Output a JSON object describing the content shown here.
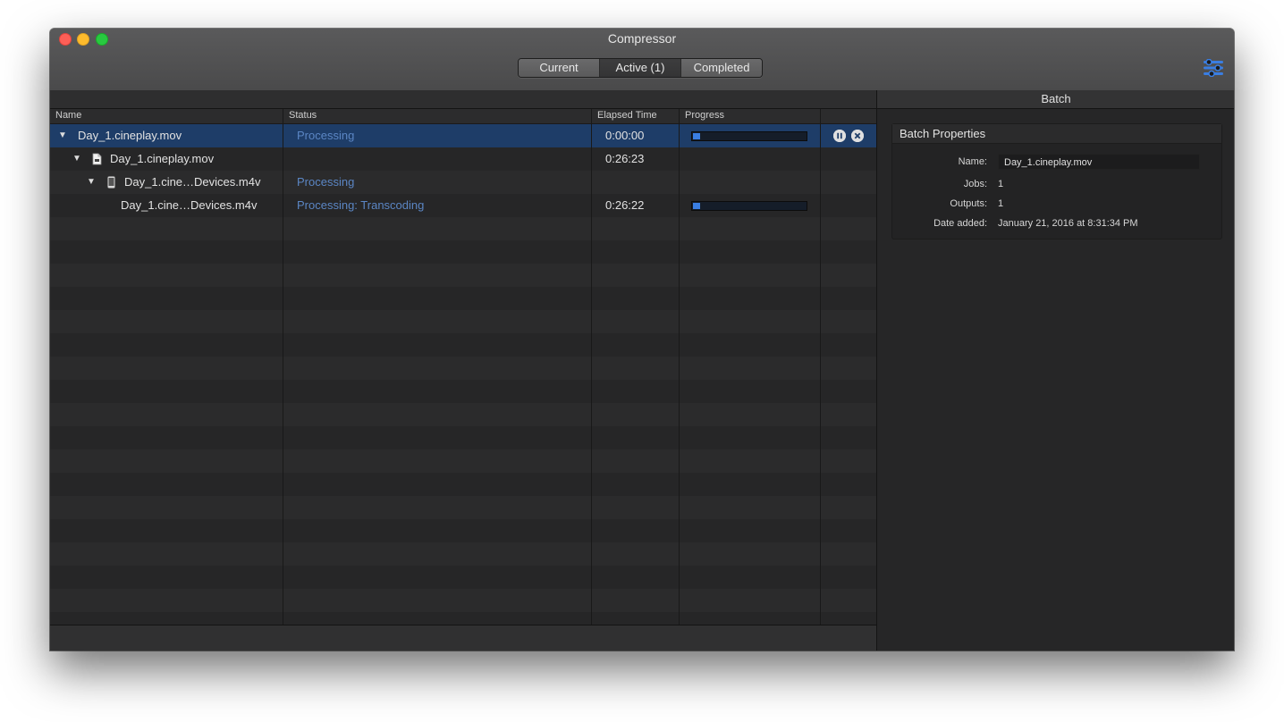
{
  "window": {
    "title": "Compressor"
  },
  "tabs": [
    {
      "label": "Current",
      "active": false
    },
    {
      "label": "Active (1)",
      "active": true
    },
    {
      "label": "Completed",
      "active": false
    }
  ],
  "settings_icon": "sliders-icon",
  "columns": {
    "name": "Name",
    "status": "Status",
    "elapsed": "Elapsed Time",
    "progress": "Progress"
  },
  "rows": [
    {
      "name": "Day_1.cineplay.mov",
      "status": "Processing",
      "elapsed": "0:00:00",
      "progress": 0.06,
      "expanded": true,
      "selected": true
    },
    {
      "name": "Day_1.cineplay.mov",
      "status": "",
      "elapsed": "0:26:23",
      "expanded": true,
      "icon": "document-icon"
    },
    {
      "name": "Day_1.cine…Devices.m4v",
      "status": "Processing",
      "elapsed": "",
      "expanded": true,
      "icon": "phone-icon"
    },
    {
      "name": "Day_1.cine…Devices.m4v",
      "status": "Processing: Transcoding",
      "elapsed": "0:26:22",
      "progress": 0.06
    }
  ],
  "inspector": {
    "header": "Batch",
    "section_title": "Batch Properties",
    "name_label": "Name:",
    "name_value": "Day_1.cineplay.mov",
    "jobs_label": "Jobs:",
    "jobs_value": "1",
    "outputs_label": "Outputs:",
    "outputs_value": "1",
    "date_label": "Date added:",
    "date_value": "January 21, 2016 at 8:31:34 PM"
  },
  "colors": {
    "accent": "#3a7ee2",
    "selection": "#1e3d68",
    "status_text": "#5b86c4"
  }
}
